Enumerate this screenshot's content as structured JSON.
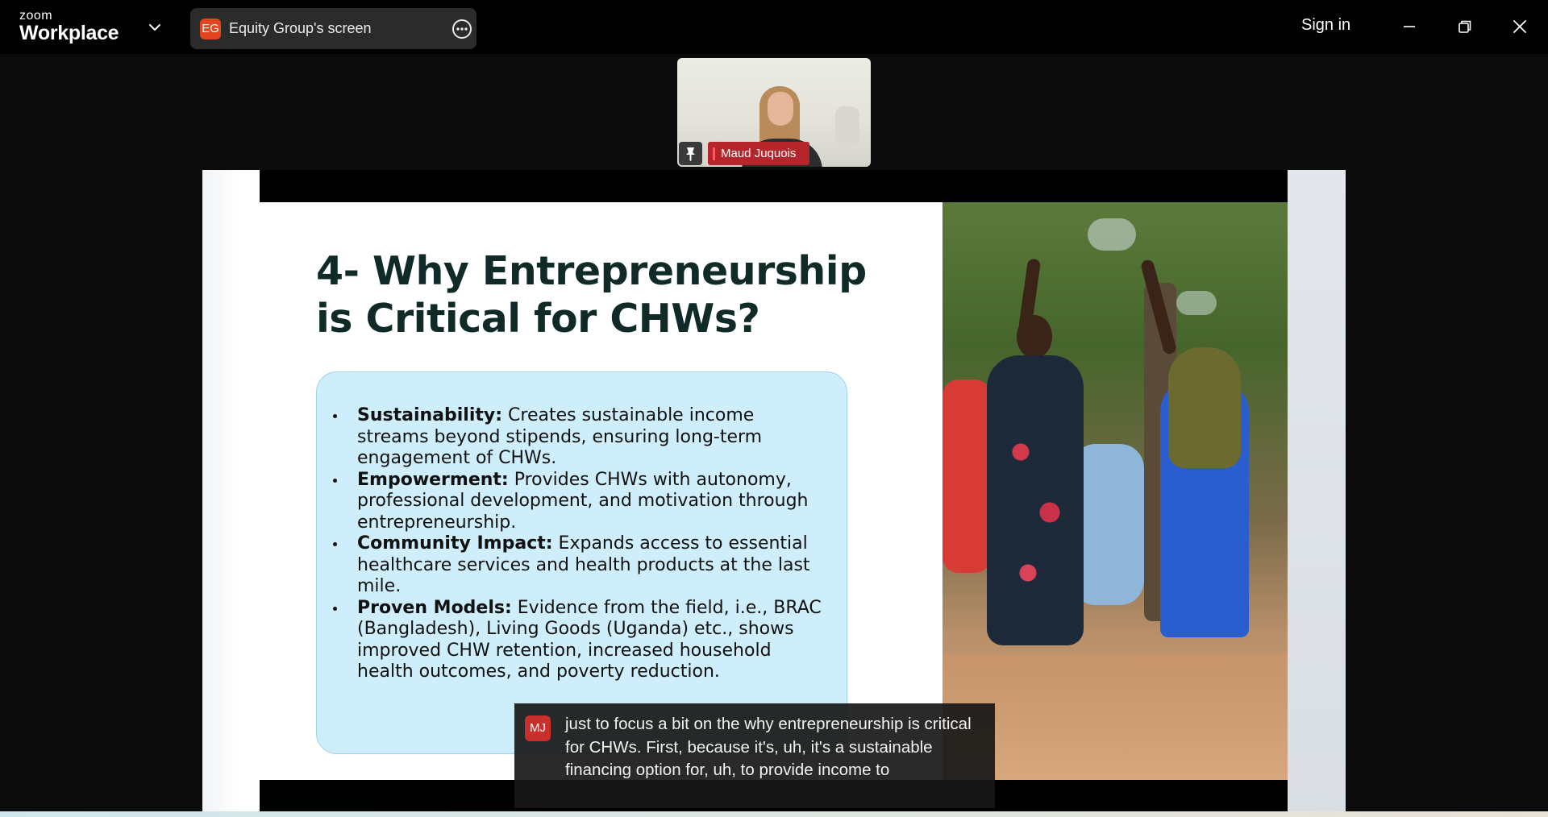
{
  "titlebar": {
    "logo_top": "zoom",
    "logo_bottom": "Workplace",
    "share": {
      "badge": "EG",
      "label": "Equity Group's screen"
    },
    "signin": "Sign in"
  },
  "participant": {
    "name": "Maud Juquois"
  },
  "slide": {
    "title_line1": "4- Why Entrepreneurship",
    "title_line2": "is Critical for CHWs?",
    "bullets": [
      {
        "heading": "Sustainability:",
        "text": " Creates sustainable income streams beyond stipends, ensuring long-term engagement of CHWs."
      },
      {
        "heading": "Empowerment:",
        "text": " Provides CHWs with autonomy, professional development, and motivation through entrepreneurship."
      },
      {
        "heading": "Community Impact:",
        "text": " Expands access to essential healthcare services and health products at the last mile."
      },
      {
        "heading": "Proven Models:",
        "text": " Evidence from the field, i.e., BRAC (Bangladesh), Living Goods (Uganda) etc., shows improved CHW retention, increased household health outcomes, and poverty reduction."
      }
    ]
  },
  "caption": {
    "avatar": "MJ",
    "text": "just to focus a bit on the why entrepreneurship is critical for CHWs. First, because it's, uh, it's a sustainable financing option for, uh, to provide income to"
  },
  "icons": {
    "chevron": "chevron-down-icon",
    "more": "more-options-icon",
    "minimize": "minimize-icon",
    "restore": "restore-icon",
    "close": "close-icon",
    "pin": "pin-icon"
  },
  "colors": {
    "accent_orange": "#e1461f",
    "name_tag_red": "#b5262c",
    "content_box": "#cdeefa",
    "title_text": "#0f2a27"
  }
}
